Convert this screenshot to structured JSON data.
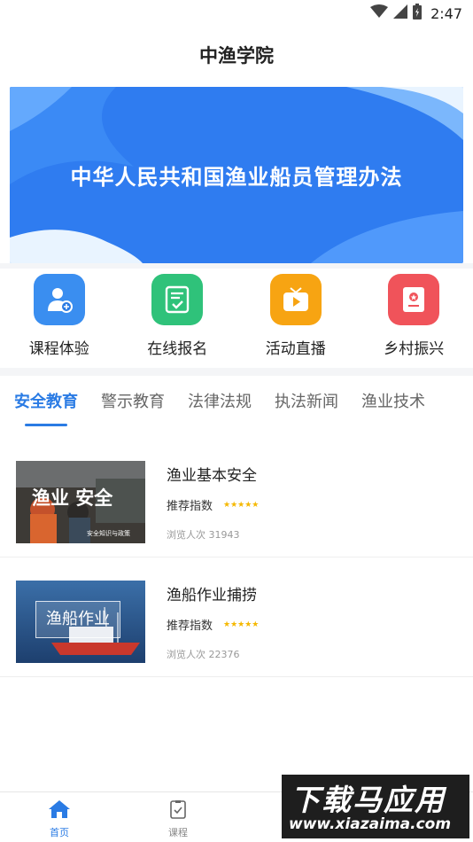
{
  "status_bar": {
    "time": "2:47"
  },
  "header": {
    "title": "中渔学院"
  },
  "banner": {
    "text": "中华人民共和国渔业船员管理办法"
  },
  "quick_actions": [
    {
      "label": "课程体验",
      "icon": "user-badge-icon",
      "color": "#3a8ef0"
    },
    {
      "label": "在线报名",
      "icon": "checklist-icon",
      "color": "#2fc27a"
    },
    {
      "label": "活动直播",
      "icon": "tv-play-icon",
      "color": "#f7a412"
    },
    {
      "label": "乡村振兴",
      "icon": "certificate-icon",
      "color": "#f0535a"
    }
  ],
  "tabs": [
    {
      "label": "安全教育",
      "active": true
    },
    {
      "label": "警示教育"
    },
    {
      "label": "法律法规"
    },
    {
      "label": "执法新闻"
    },
    {
      "label": "渔业技术"
    }
  ],
  "courses": [
    {
      "title": "渔业基本安全",
      "rating_label": "推荐指数",
      "stars": "★★★★★",
      "views": "浏览人次 31943",
      "thumb_text": "渔业 安全",
      "thumb_subtext": "安全知识与政策"
    },
    {
      "title": "渔船作业捕捞",
      "rating_label": "推荐指数",
      "stars": "★★★★★",
      "views": "浏览人次 22376",
      "thumb_text": "渔船作业"
    }
  ],
  "bottom_nav": [
    {
      "label": "首页",
      "icon": "home-icon",
      "active": true
    },
    {
      "label": "课程",
      "icon": "course-checklist-icon"
    }
  ],
  "watermark": {
    "main": "下载马应用",
    "url": "www.xiazaima.com"
  },
  "colors": {
    "accent": "#2a7be4",
    "banner": "#2f7cf0",
    "star": "#f5b800"
  }
}
